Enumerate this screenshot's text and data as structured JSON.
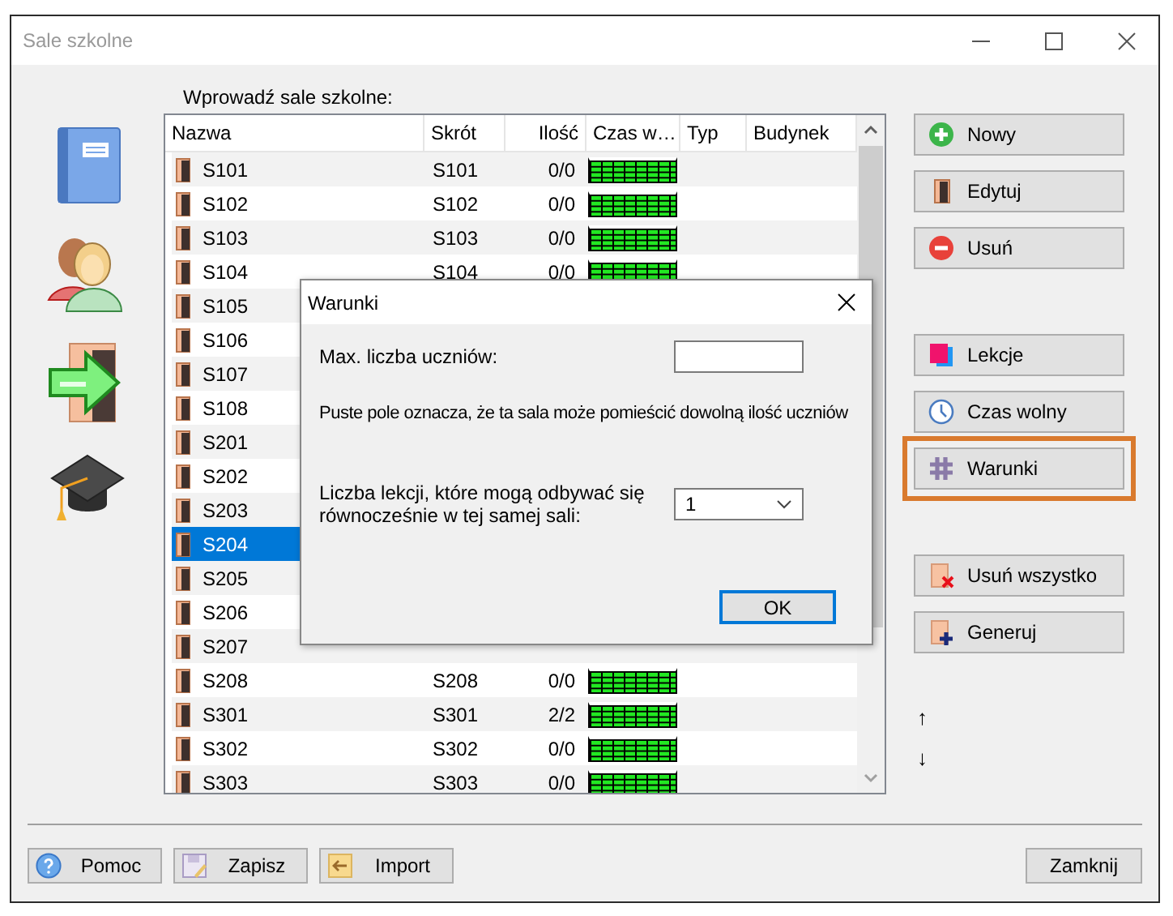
{
  "window": {
    "title": "Sale szkolne"
  },
  "list": {
    "label": "Wprowadź sale szkolne:",
    "columns": [
      "Nazwa",
      "Skrót",
      "Ilość",
      "Czas w…",
      "Typ",
      "Budynek"
    ],
    "rows": [
      {
        "name": "S101",
        "short": "S101",
        "count": "0/0",
        "selected": false
      },
      {
        "name": "S102",
        "short": "S102",
        "count": "0/0",
        "selected": false
      },
      {
        "name": "S103",
        "short": "S103",
        "count": "0/0",
        "selected": false
      },
      {
        "name": "S104",
        "short": "S104",
        "count": "0/0",
        "selected": false
      },
      {
        "name": "S105",
        "selected": false
      },
      {
        "name": "S106",
        "selected": false
      },
      {
        "name": "S107",
        "selected": false
      },
      {
        "name": "S108",
        "selected": false
      },
      {
        "name": "S201",
        "selected": false
      },
      {
        "name": "S202",
        "selected": false
      },
      {
        "name": "S203",
        "selected": false
      },
      {
        "name": "S204",
        "selected": true
      },
      {
        "name": "S205",
        "selected": false
      },
      {
        "name": "S206",
        "selected": false
      },
      {
        "name": "S207",
        "selected": false
      },
      {
        "name": "S208",
        "short": "S208",
        "count": "0/0",
        "selected": false
      },
      {
        "name": "S301",
        "short": "S301",
        "count": "2/2",
        "selected": false
      },
      {
        "name": "S302",
        "short": "S302",
        "count": "0/0",
        "selected": false
      },
      {
        "name": "S303",
        "short": "S303",
        "count": "0/0",
        "selected": false
      }
    ]
  },
  "actions": [
    [
      {
        "label": "Nowy",
        "kind": "add"
      },
      {
        "label": "Edytuj",
        "kind": "edit"
      },
      {
        "label": "Usuń",
        "kind": "delete"
      }
    ],
    [
      {
        "label": "Lekcje",
        "kind": "lessons"
      },
      {
        "label": "Czas wolny",
        "kind": "free-time"
      },
      {
        "label": "Warunki",
        "kind": "conditions",
        "highlighted": true
      }
    ],
    [
      {
        "label": "Usuń wszystko",
        "kind": "delete-all"
      },
      {
        "label": "Generuj",
        "kind": "generate"
      }
    ]
  ],
  "move": [
    "↑",
    "↓"
  ],
  "footer": {
    "buttons": [
      {
        "label": "Pomoc",
        "kind": "help"
      },
      {
        "label": "Zapisz",
        "kind": "save"
      },
      {
        "label": "Import",
        "kind": "import"
      }
    ],
    "close": "Zamknij"
  },
  "dialog": {
    "title": "Warunki",
    "max_label": "Max. liczba uczniów:",
    "hint": "Puste pole oznacza, że ta sala może pomieścić dowolną ilość uczniów",
    "lessons_label": "Liczba lekcji, które mogą odbywać się równocześnie w tej samej sali:",
    "lessons_value": "1",
    "ok": "OK"
  }
}
